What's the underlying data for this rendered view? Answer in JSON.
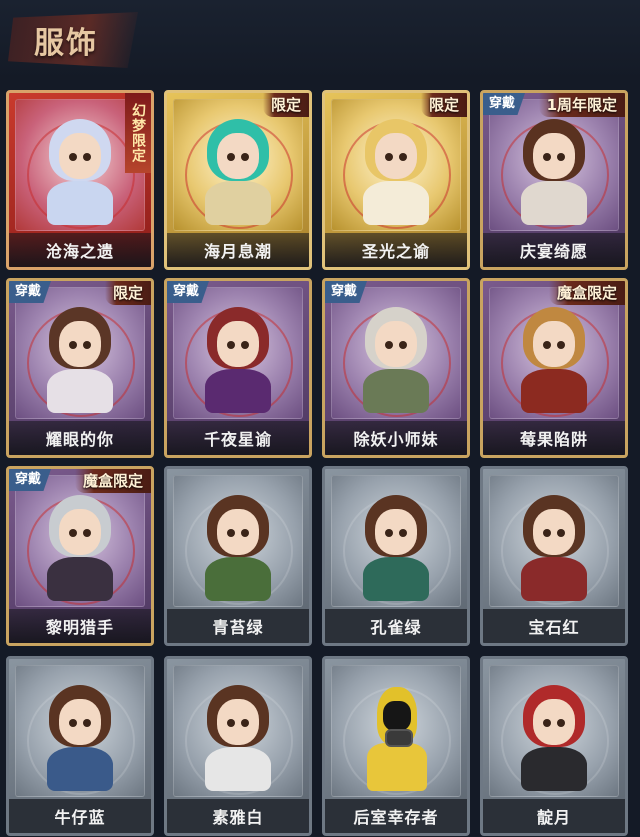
{
  "header": {
    "title": "服饰"
  },
  "cards": [
    {
      "name": "沧海之遗",
      "style": "red",
      "tag_vertical": "幻梦限定",
      "hair": "#cfd8f0",
      "outfit": "#c9d6f0"
    },
    {
      "name": "海月息潮",
      "style": "gold",
      "tag_right": "限定",
      "hair": "#2fbfa8",
      "outfit": "#e0d0a0"
    },
    {
      "name": "圣光之谕",
      "style": "gold",
      "tag_right": "限定",
      "hair": "#e8c667",
      "outfit": "#f4ecd8"
    },
    {
      "name": "庆宴绮愿",
      "style": "purple",
      "tag_wear": "穿戴",
      "tag_right": "1周年限定",
      "hair": "#5a3220",
      "outfit": "#e0d8cf"
    },
    {
      "name": "耀眼的你",
      "style": "purple",
      "tag_wear": "穿戴",
      "tag_right": "限定",
      "hair": "#5b3626",
      "outfit": "#e6e0e6"
    },
    {
      "name": "千夜星谕",
      "style": "purple",
      "tag_wear": "穿戴",
      "hair": "#8a2a2a",
      "outfit": "#5a2a70"
    },
    {
      "name": "除妖小师妹",
      "style": "purple",
      "tag_wear": "穿戴",
      "hair": "#d6d2ca",
      "outfit": "#6a7a56"
    },
    {
      "name": "莓果陷阱",
      "style": "purple",
      "tag_right": "魔盒限定",
      "hair": "#c08840",
      "outfit": "#8c2a20"
    },
    {
      "name": "黎明猎手",
      "style": "purple",
      "tag_wear": "穿戴",
      "tag_right": "魔盒限定",
      "hair": "#c8ccd0",
      "outfit": "#3a3040"
    },
    {
      "name": "青苔绿",
      "style": "gray",
      "hair": "#5a3422",
      "outfit": "#4a6e3a"
    },
    {
      "name": "孔雀绿",
      "style": "gray",
      "hair": "#5a3422",
      "outfit": "#2e6a5a"
    },
    {
      "name": "宝石红",
      "style": "gray",
      "hair": "#5a3422",
      "outfit": "#8a2a2a"
    },
    {
      "name": "牛仔蓝",
      "style": "gray",
      "hair": "#5a3422",
      "outfit": "#3a5a8a"
    },
    {
      "name": "素雅白",
      "style": "gray",
      "hair": "#5a3422",
      "outfit": "#e6e6e6"
    },
    {
      "name": "后室幸存者",
      "style": "gray",
      "special": "gasmask"
    },
    {
      "name": "靛月",
      "style": "gray",
      "hair": "#b02a2a",
      "outfit": "#2a2a2e"
    }
  ]
}
